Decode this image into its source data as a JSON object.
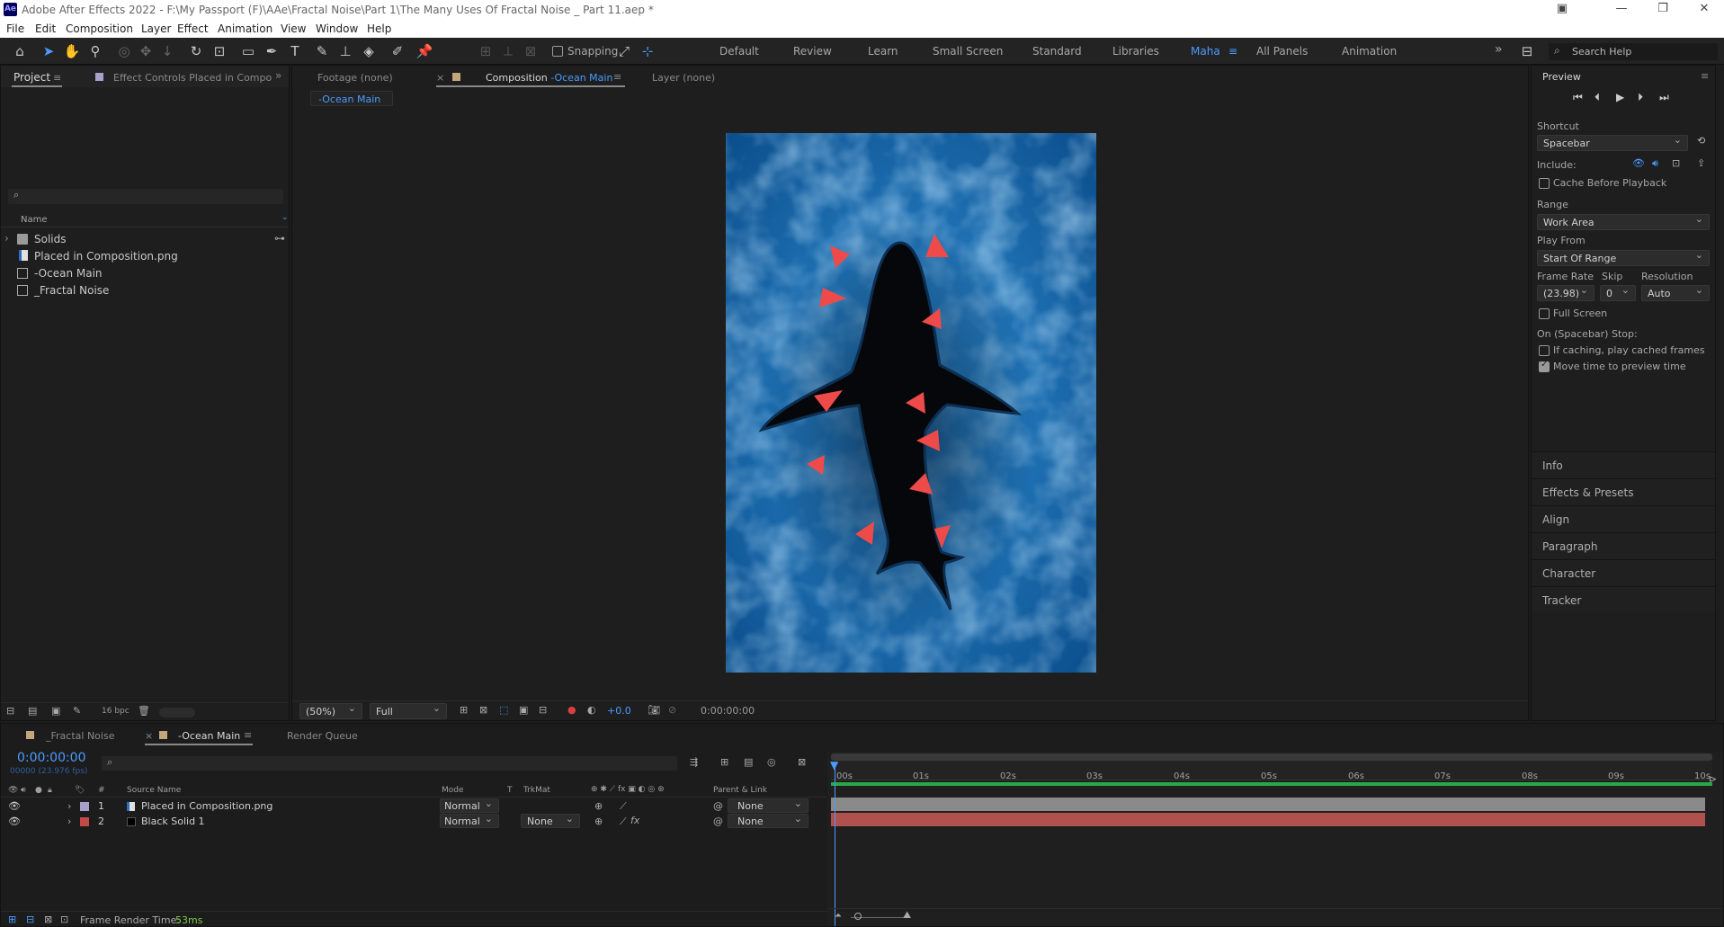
{
  "window": {
    "title": "Adobe After Effects 2022 - F:\\My Passport (F)\\AAe\\Fractal Noise\\Part 1\\The Many Uses Of Fractal Noise _ Part 11.aep *",
    "logo": "Ae"
  },
  "menu": [
    "File",
    "Edit",
    "Composition",
    "Layer",
    "Effect",
    "Animation",
    "View",
    "Window",
    "Help"
  ],
  "toolbar": {
    "snapping_label": "Snapping",
    "workspaces": [
      "Default",
      "Review",
      "Learn",
      "Small Screen",
      "Standard",
      "Libraries",
      "Maha",
      "All Panels",
      "Animation"
    ],
    "active_workspace": "Maha",
    "search_placeholder": "Search Help",
    "overflow": "»"
  },
  "project_panel": {
    "tab": "Project",
    "effect_controls_tab": "Effect Controls Placed in Compo",
    "search_glyph": "⌕",
    "column_name": "Name",
    "items": [
      {
        "name": "Solids",
        "type": "folder"
      },
      {
        "name": "Placed in Composition.png",
        "type": "image"
      },
      {
        "name": "-Ocean Main",
        "type": "comp"
      },
      {
        "name": "_Fractal Noise",
        "type": "comp"
      }
    ],
    "bpc": "16 bpc"
  },
  "viewer": {
    "footage_tab": "Footage (none)",
    "comp_tab_prefix": "Composition",
    "comp_tab_name": "-Ocean Main",
    "layer_tab": "Layer (none)",
    "breadcrumb": "-Ocean Main",
    "zoom": "(50%)",
    "resolution": "Full",
    "exposure": "+0.0",
    "timecode": "0:00:00:00",
    "colors": {
      "water_deep": "#0b4e8c",
      "water_light": "#2f8fd6",
      "arrow": "#ee4a4a",
      "shark": "#05070a"
    }
  },
  "preview": {
    "title": "Preview",
    "shortcut_label": "Shortcut",
    "shortcut_value": "Spacebar",
    "include_label": "Include:",
    "cache_before_playback": "Cache Before Playback",
    "range_label": "Range",
    "range_value": "Work Area",
    "play_from_label": "Play From",
    "play_from_value": "Start Of Range",
    "frame_rate_label": "Frame Rate",
    "frame_rate_value": "(23.98)",
    "skip_label": "Skip",
    "skip_value": "0",
    "resolution_label": "Resolution",
    "resolution_value": "Auto",
    "full_screen": "Full Screen",
    "stop_label": "On (Spacebar) Stop:",
    "if_caching": "If caching, play cached frames",
    "move_time": "Move time to preview time",
    "full_screen_checked": false,
    "cache_checked": false,
    "if_caching_checked": false,
    "move_time_checked": true
  },
  "side_sections": [
    "Info",
    "Effects & Presets",
    "Align",
    "Paragraph",
    "Character",
    "Tracker"
  ],
  "timeline": {
    "tabs": [
      "_Fractal Noise",
      "-Ocean Main",
      "Render Queue"
    ],
    "active_tab": "-Ocean Main",
    "timecode": "0:00:00:00",
    "fps": "00000 (23.976 fps)",
    "headers": {
      "num": "#",
      "source": "Source Name",
      "mode": "Mode",
      "t": "T",
      "trkmat": "TrkMat",
      "parent": "Parent & Link"
    },
    "layers": [
      {
        "num": "1",
        "name": "Placed in Composition.png",
        "mode": "Normal",
        "trkmat": "",
        "parent": "None",
        "color": "#a7a0c9",
        "bar": "#8a8a8a"
      },
      {
        "num": "2",
        "name": "Black Solid 1",
        "mode": "Normal",
        "trkmat": "None",
        "parent": "None",
        "color": "#c44a4a",
        "bar": "#b0504f"
      }
    ],
    "ruler": [
      "00s",
      "01s",
      "02s",
      "03s",
      "04s",
      "05s",
      "06s",
      "07s",
      "08s",
      "09s",
      "10s"
    ],
    "render_time_label": "Frame Render Time:",
    "render_time_value": "53ms"
  }
}
